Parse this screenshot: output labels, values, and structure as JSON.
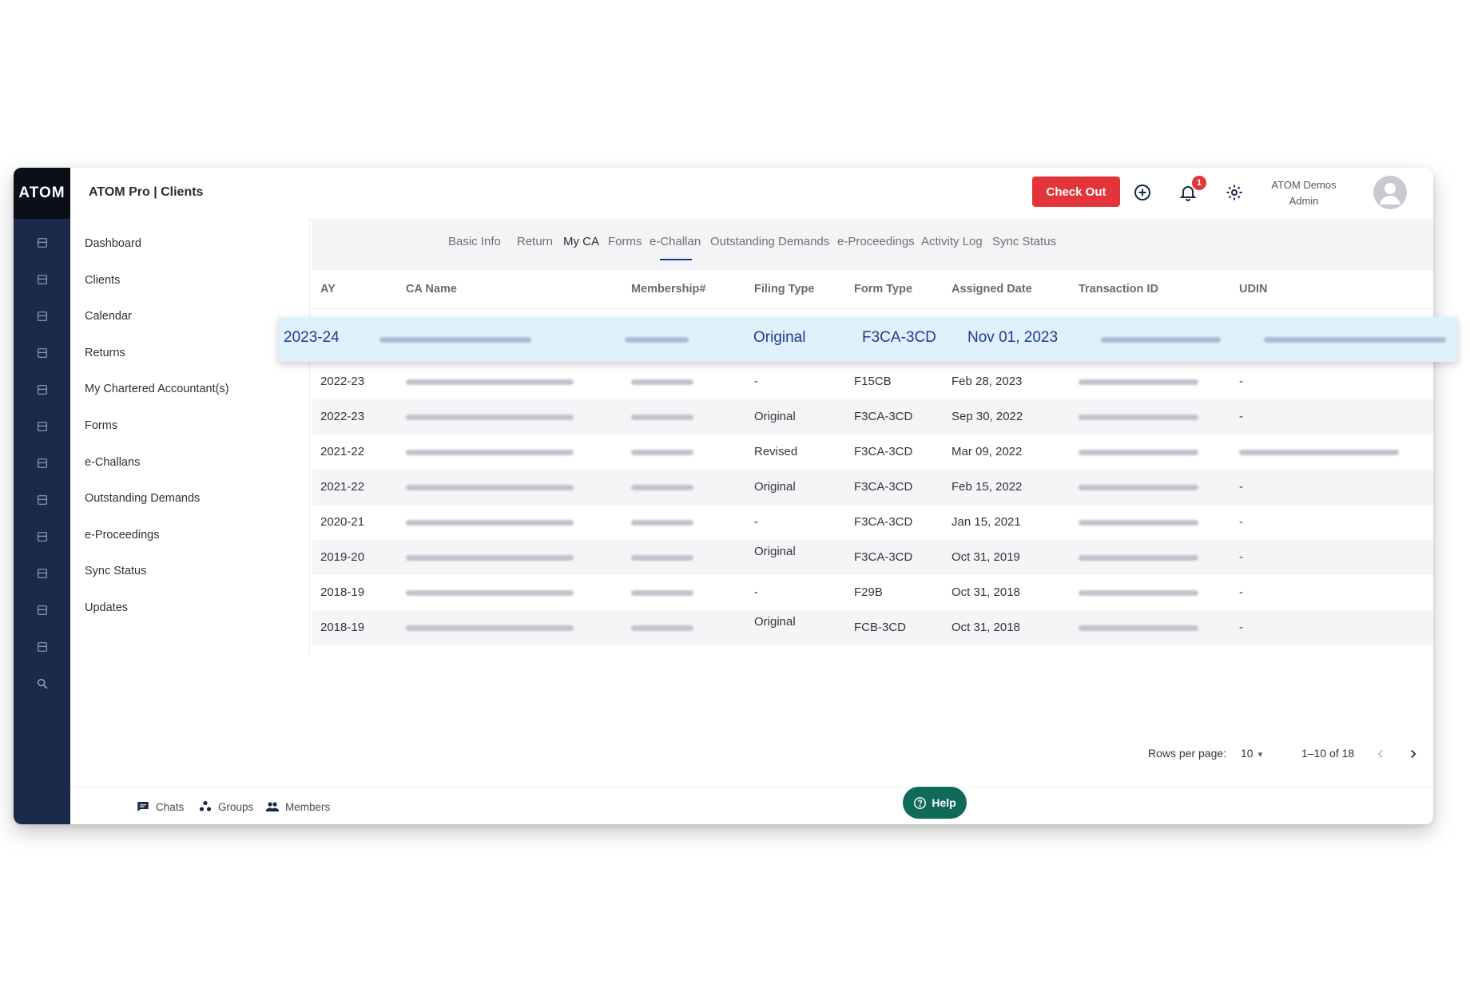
{
  "app": {
    "logo": "ATOM",
    "title": "ATOM Pro | Clients",
    "checkout_label": "Check Out",
    "notification_count": "1",
    "user_name": "ATOM Demos",
    "user_role": "Admin",
    "rail_icons": [
      "dashboard-icon",
      "clients-icon",
      "calendar-icon",
      "returns-icon",
      "ca-icon",
      "forms-icon",
      "challans-icon",
      "demands-icon",
      "proceedings-icon",
      "sync-icon",
      "updates-icon",
      "report-icon",
      "search-icon"
    ]
  },
  "sidebar": {
    "items": [
      {
        "label": "Dashboard"
      },
      {
        "label": "Clients"
      },
      {
        "label": "Calendar"
      },
      {
        "label": "Returns"
      },
      {
        "label": "My Chartered Accountant(s)"
      },
      {
        "label": "Forms"
      },
      {
        "label": "e-Challans"
      },
      {
        "label": "Outstanding Demands"
      },
      {
        "label": "e-Proceedings"
      },
      {
        "label": "Sync Status"
      },
      {
        "label": "Updates"
      }
    ]
  },
  "tabs": [
    {
      "label": "Basic Info"
    },
    {
      "label": "Return"
    },
    {
      "label": "My CA"
    },
    {
      "label": "Forms"
    },
    {
      "label": "e-Challan"
    },
    {
      "label": "Outstanding Demands"
    },
    {
      "label": "e-Proceedings"
    },
    {
      "label": "Activity Log"
    },
    {
      "label": "Sync Status"
    }
  ],
  "table": {
    "columns": [
      "AY",
      "CA Name",
      "Membership#",
      "Filing Type",
      "Form Type",
      "Assigned Date",
      "Transaction ID",
      "UDIN"
    ],
    "highlighted_row": {
      "ay": "2023-24",
      "filing_type": "Original",
      "form_type": "F3CA-3CD",
      "assigned_date": "Nov 01, 2023"
    },
    "rows": [
      {
        "ay": "2022-23",
        "filing_type": "-",
        "form_type": "F15CB",
        "assigned_date": "Feb 28, 2023",
        "udin": "-"
      },
      {
        "ay": "2022-23",
        "filing_type": "Original",
        "form_type": "F3CA-3CD",
        "assigned_date": "Sep 30, 2022",
        "udin": "-"
      },
      {
        "ay": "2021-22",
        "filing_type": "Revised",
        "form_type": "F3CA-3CD",
        "assigned_date": "Mar 09, 2022",
        "udin": ""
      },
      {
        "ay": "2021-22",
        "filing_type": "Original",
        "form_type": "F3CA-3CD",
        "assigned_date": "Feb 15, 2022",
        "udin": "-"
      },
      {
        "ay": "2020-21",
        "filing_type": "-",
        "form_type": "F3CA-3CD",
        "assigned_date": "Jan 15, 2021",
        "udin": "-"
      },
      {
        "ay": "2019-20",
        "filing_type": "Original",
        "form_type": "F3CA-3CD",
        "assigned_date": "Oct 31, 2019",
        "udin": "-"
      },
      {
        "ay": "2018-19",
        "filing_type": "-",
        "form_type": "F29B",
        "assigned_date": "Oct 31, 2018",
        "udin": "-"
      },
      {
        "ay": "2018-19",
        "filing_type": "Original",
        "form_type": "FCB-3CD",
        "assigned_date": "Oct 31, 2018",
        "udin": "-"
      }
    ]
  },
  "pagination": {
    "rows_per_page_label": "Rows per page:",
    "rows_per_page_value": "10",
    "range": "1–10 of 18"
  },
  "footer": {
    "chats": "Chats",
    "groups": "Groups",
    "members": "Members",
    "help": "Help"
  },
  "colors": {
    "rail": "#1b2a4a",
    "accent": "#1f3a93",
    "checkout": "#e3343a",
    "help": "#0f6a5a",
    "highlight": "#dff1fa"
  }
}
